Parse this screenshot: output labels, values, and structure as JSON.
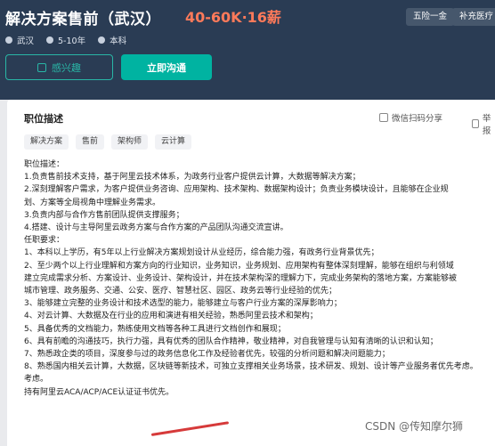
{
  "job": {
    "title": "解决方案售前（武汉）",
    "salary": "40-60K·16薪",
    "tags": [
      "五险一金",
      "补充医疗"
    ],
    "meta": [
      "武汉",
      "5-10年",
      "本科"
    ]
  },
  "actions": {
    "interested": "感兴趣",
    "chat": "立即沟通"
  },
  "card": {
    "title": "职位描述",
    "tools": {
      "wechat": "微信扫码分享",
      "report": "举报"
    },
    "skills": [
      "解决方案",
      "售前",
      "架构师",
      "云计算"
    ],
    "lines": [
      "职位描述：",
      "1.负责售前技术支持，基于阿里云技术体系，为政务行业客户提供云计算，大数据等解决方案；",
      "2.深刻理解客户需求，为客户提供业务咨询、应用架构、技术架构、数据架构设计；负责业务模块设计，且能够在企业规",
      "划、方案等全局视角中理解业务需求。",
      "3.负责内部与合作方售前团队提供支撑服务；",
      "4.搭建、设计与主导阿里云政务方案与合作方案的产品团队沟通交流宣讲。",
      "任职要求：",
      "1、本科以上学历，有5年以上行业解决方案规划设计从业经历，综合能力强，有政务行业背景优先；",
      "2、至少两个以上行业理解和方案方向的行业知识，业务知识，业务规划、应用架构有整体深刻理解，能够在组织与利领域",
      "建立完成需求分析、方案设计、业务设计、架构设计，并在技术架构深的理解力下，完成业务架构的落地方案，方案能够被",
      "城市管理、政务服务、交通、公安、医疗、智慧社区、园区、政务云等行业经验的优先；",
      "3、能够建立完整的业务设计和技术选型的能力，能够建立与客户行业方案的深厚影响力；",
      "4、对云计算、大数据及在行业的应用和演进有相关经验，熟悉阿里云技术和架构；",
      "5、具备优秀的文档能力，熟练使用文档等各种工具进行文档创作和展现；",
      "6、具有前瞻的沟通技巧，执行力强，具有优秀的团队合作精神，敬业精神，对自我管理与认知有清晰的认识和认知；",
      "7、熟悉政企类的项目，深度参与过的政务信息化工作及经验者优先，较强的分析问题和解决问题能力；",
      "8、熟悉国内相关云计算，大数据，区块链等新技术，可独立支撑相关业务场景，技术研发、规划、设计等产业服务者优先考虑。",
      "考虑。",
      "持有阿里云ACA/ACP/ACE认证证书优先。"
    ]
  },
  "watermark": "CSDN @传知摩尔狮"
}
